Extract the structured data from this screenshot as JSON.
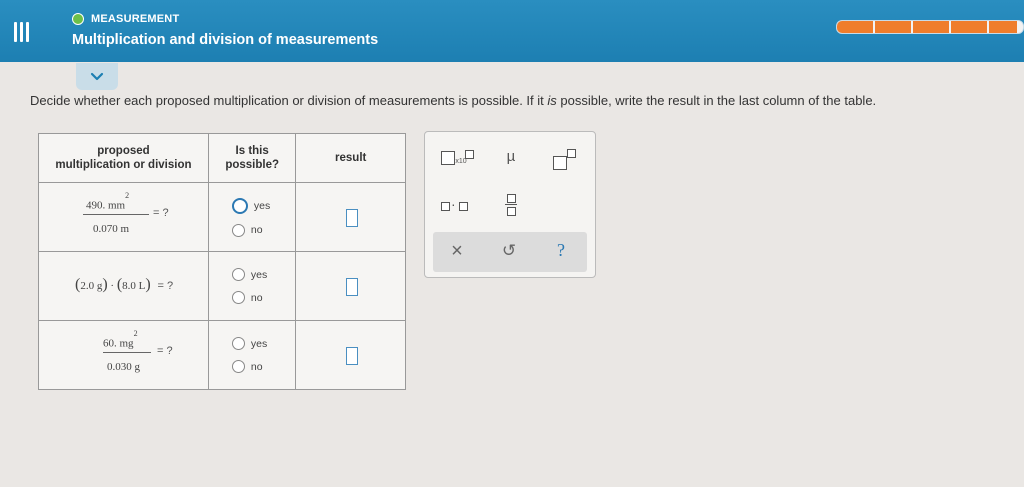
{
  "header": {
    "topic": "MEASUREMENT",
    "title": "Multiplication and division of measurements",
    "progress_fraction": 0.97
  },
  "instructions": {
    "part1": "Decide whether each proposed multiplication or division of measurements is possible. If it ",
    "italic": "is",
    "part2": " possible, write the result in the last column of the table."
  },
  "table": {
    "col1_line1": "proposed",
    "col1_line2": "multiplication or division",
    "col2_line1": "Is this",
    "col2_line2": "possible?",
    "col3": "result",
    "rows": [
      {
        "numerator": "490. mm",
        "numerator_exp": "2",
        "denominator": "0.070 m",
        "equals": "= ?",
        "yes": "yes",
        "no": "no"
      },
      {
        "term1_open": "(",
        "term1": "2.0 g",
        "term1_close": ")",
        "dot": "·",
        "term2_open": "(",
        "term2": "8.0 L",
        "term2_close": ")",
        "equals": "= ?",
        "yes": "yes",
        "no": "no"
      },
      {
        "numerator": "60. mg",
        "numerator_exp": "2",
        "denominator": "0.030 g",
        "equals": "= ?",
        "yes": "yes",
        "no": "no"
      }
    ]
  },
  "palette": {
    "sci_sub": "x10",
    "mu": "µ",
    "dot": "·",
    "clear": "×",
    "undo": "↺",
    "help": "?"
  },
  "colors": {
    "header_blue": "#1d7fb2",
    "progress_orange": "#ef7d2b",
    "topic_green": "#6cc04a",
    "input_blue": "#4a8fc1"
  }
}
